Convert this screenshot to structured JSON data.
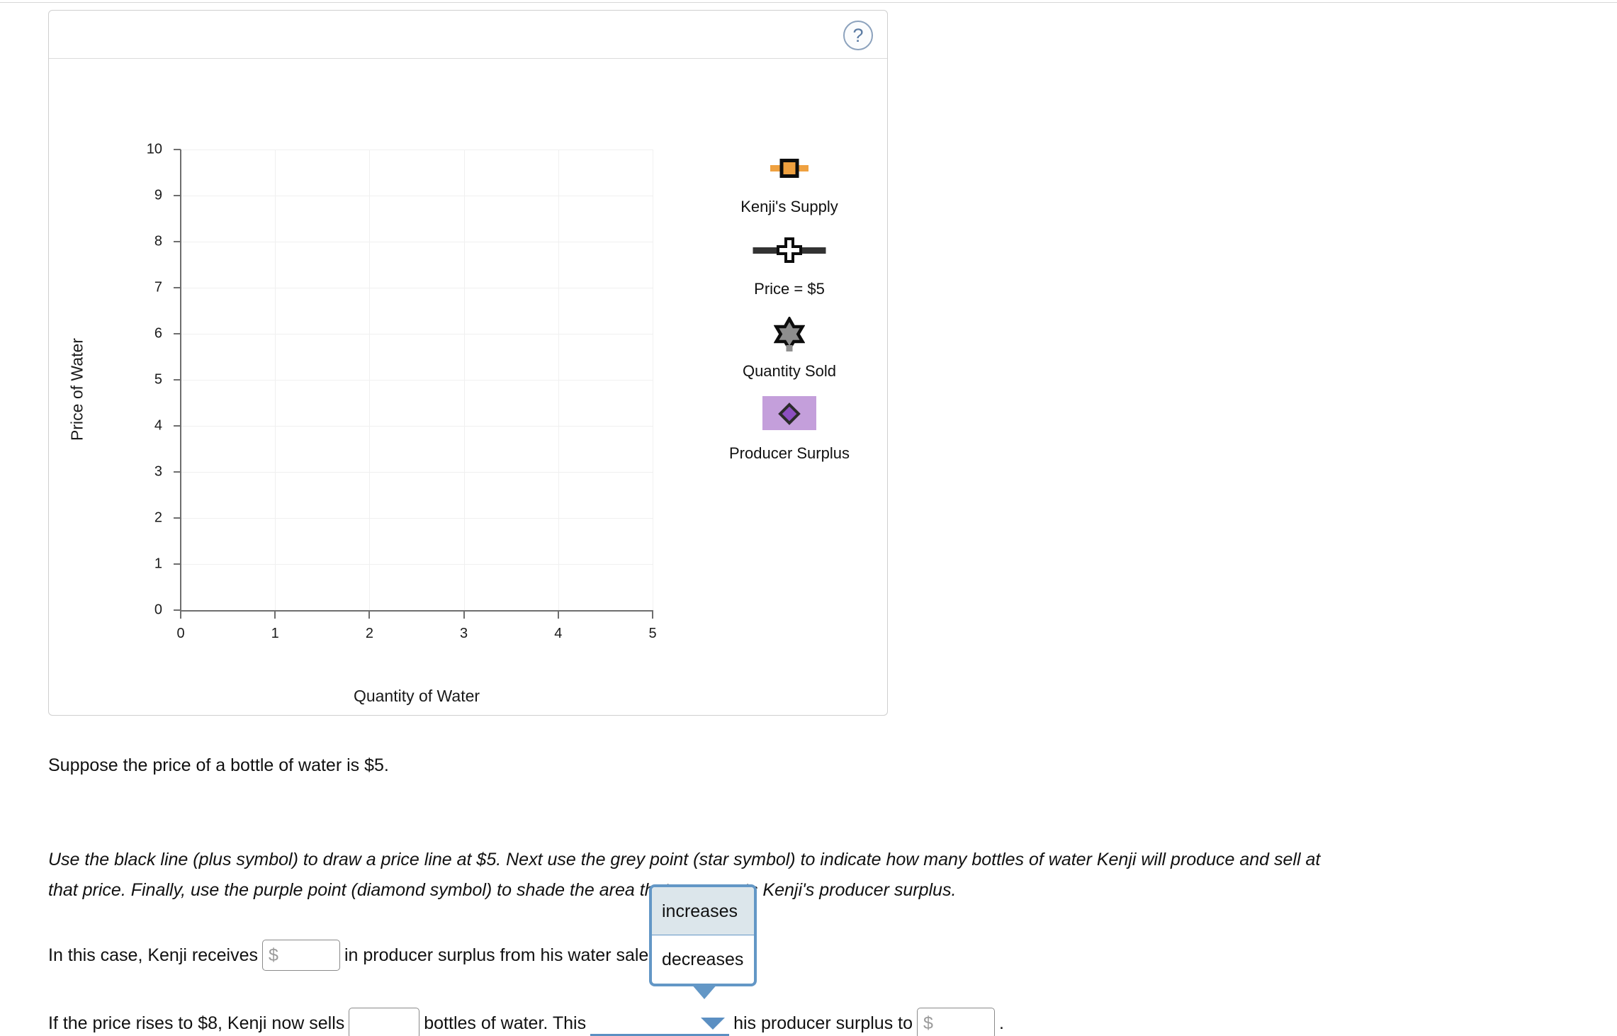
{
  "panel": {
    "help_icon": "?",
    "help_label": "help-button"
  },
  "chart_data": {
    "type": "scatter",
    "title": "",
    "xlabel": "Quantity of Water",
    "ylabel": "Price of Water",
    "xlim": [
      0,
      5
    ],
    "ylim": [
      0,
      10
    ],
    "xticks": [
      "0",
      "1",
      "2",
      "3",
      "4",
      "5"
    ],
    "yticks": [
      "0",
      "1",
      "2",
      "3",
      "4",
      "5",
      "6",
      "7",
      "8",
      "9",
      "10"
    ],
    "grid": true,
    "legend_position": "right",
    "series": [],
    "legend": [
      {
        "label": "Kenji's Supply",
        "symbol": "orange-line-square",
        "color": "#efa140",
        "edge": "#0d0d0d"
      },
      {
        "label": "Price = $5",
        "symbol": "black-line-plus",
        "color": "#333333",
        "edge": "#0d0d0d"
      },
      {
        "label": "Quantity Sold",
        "symbol": "grey-star",
        "color": "#8e8e8e",
        "edge": "#0d0d0d"
      },
      {
        "label": "Producer Surplus",
        "symbol": "purple-diamond-patch",
        "color": "#c49fdb",
        "edge": "#6f3fa8"
      }
    ]
  },
  "body": {
    "paragraph_1": "Suppose the price of a bottle of water is $5.",
    "instructions": "Use the black line (plus symbol) to draw a price line at $5. Next use the grey point (star symbol) to indicate how many bottles of water Kenji will produce and sell at that price. Finally, use the purple point (diamond symbol) to shade the area that represents Kenji's producer surplus."
  },
  "question_1": {
    "text_before": "In this case, Kenji receives",
    "input_value": "",
    "input_placeholder": "$",
    "text_after": "in producer surplus from his water sales."
  },
  "question_2": {
    "text_before": "If the price rises to $8, Kenji now sells",
    "input_value": "",
    "input_placeholder": "",
    "text_middle": "bottles of water. This",
    "select_value": "",
    "text_after": "his producer surplus to",
    "input2_value": "",
    "input2_placeholder": "$",
    "text_end": "."
  },
  "dropdown": {
    "open": true,
    "options": [
      "increases",
      "decreases"
    ],
    "selected_index": 0
  }
}
